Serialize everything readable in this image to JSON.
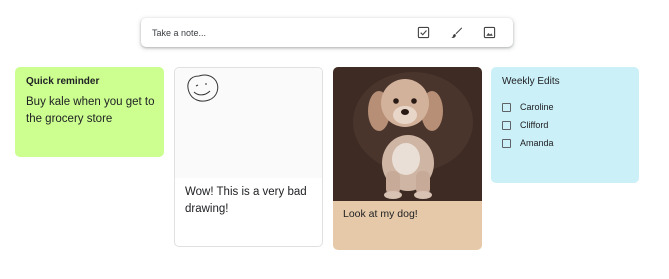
{
  "take_note": {
    "placeholder": "Take a note...",
    "tools": [
      {
        "name": "new-list-icon"
      },
      {
        "name": "new-drawing-icon"
      },
      {
        "name": "new-image-icon"
      }
    ]
  },
  "notes": {
    "quick": {
      "title": "Quick reminder",
      "body": "Buy kale when you get to the grocery store",
      "color": "#ccff90"
    },
    "drawing": {
      "body": "Wow! This is a very bad drawing!",
      "drawing_icon": "smiley-face-drawing"
    },
    "dog": {
      "body": "Look at my dog!",
      "image_icon": "puppy-photo",
      "color": "#e6c9a8"
    },
    "weekly": {
      "title": "Weekly Edits",
      "color": "#cbf0f8",
      "items": [
        {
          "label": "Caroline",
          "checked": false
        },
        {
          "label": "Clifford",
          "checked": false
        },
        {
          "label": "Amanda",
          "checked": false
        }
      ]
    }
  }
}
